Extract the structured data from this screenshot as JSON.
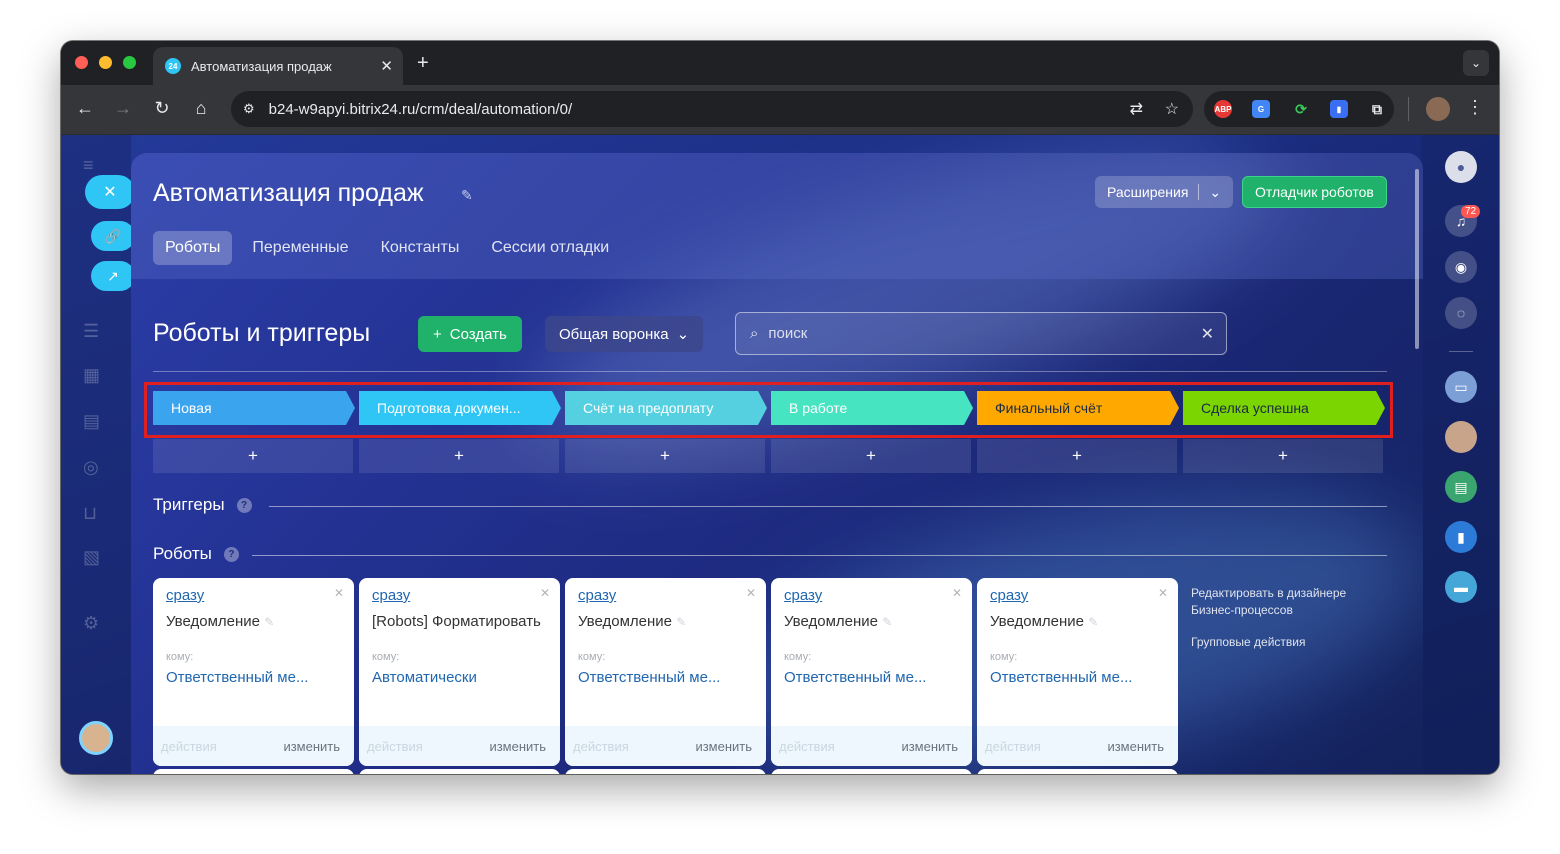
{
  "browser": {
    "tab_title": "Автоматизация продаж",
    "tab_favicon": "24",
    "url": "b24-w9apyi.bitrix24.ru/crm/deal/automation/0/"
  },
  "header": {
    "title": "Автоматизация продаж",
    "extensions_label": "Расширения",
    "debugger_label": "Отладчик роботов",
    "tabs": [
      "Роботы",
      "Переменные",
      "Константы",
      "Сессии отладки"
    ]
  },
  "toolbar": {
    "section_title": "Роботы и триггеры",
    "create_label": "Создать",
    "funnel_label": "Общая воронка",
    "search_placeholder": "поиск"
  },
  "stages": [
    {
      "label": "Новая",
      "color": "#3ba4ee"
    },
    {
      "label": "Подготовка докумен...",
      "color": "#2fc6f6"
    },
    {
      "label": "Счёт на предоплату",
      "color": "#55d0e0"
    },
    {
      "label": "В работе",
      "color": "#47e4c2"
    },
    {
      "label": "Финальный счёт",
      "color": "#ffa900"
    },
    {
      "label": "Сделка успешна",
      "color": "#7bd500"
    }
  ],
  "triggers_label": "Триггеры",
  "robots_label": "Роботы",
  "cards": [
    {
      "time": "сразу",
      "name": "Уведомление",
      "to_label": "кому:",
      "to_value": "Ответственный ме...",
      "actions": "действия",
      "edit": "изменить"
    },
    {
      "time": "сразу",
      "name": "[Robots] Форматировать",
      "to_label": "кому:",
      "to_value": "Автоматически",
      "actions": "действия",
      "edit": "изменить"
    },
    {
      "time": "сразу",
      "name": "Уведомление",
      "to_label": "кому:",
      "to_value": "Ответственный ме...",
      "actions": "действия",
      "edit": "изменить"
    },
    {
      "time": "сразу",
      "name": "Уведомление",
      "to_label": "кому:",
      "to_value": "Ответственный ме...",
      "actions": "действия",
      "edit": "изменить"
    },
    {
      "time": "сразу",
      "name": "Уведомление",
      "to_label": "кому:",
      "to_value": "Ответственный ме...",
      "actions": "действия",
      "edit": "изменить"
    }
  ],
  "side_links": {
    "designer": "Редактировать в дизайнере Бизнес-процессов",
    "group_actions": "Групповые действия"
  },
  "notifications_count": "72",
  "colors": {
    "accent_green": "#20b16a",
    "accent_blue": "#2fc6f6",
    "highlight_red": "#e02020"
  }
}
